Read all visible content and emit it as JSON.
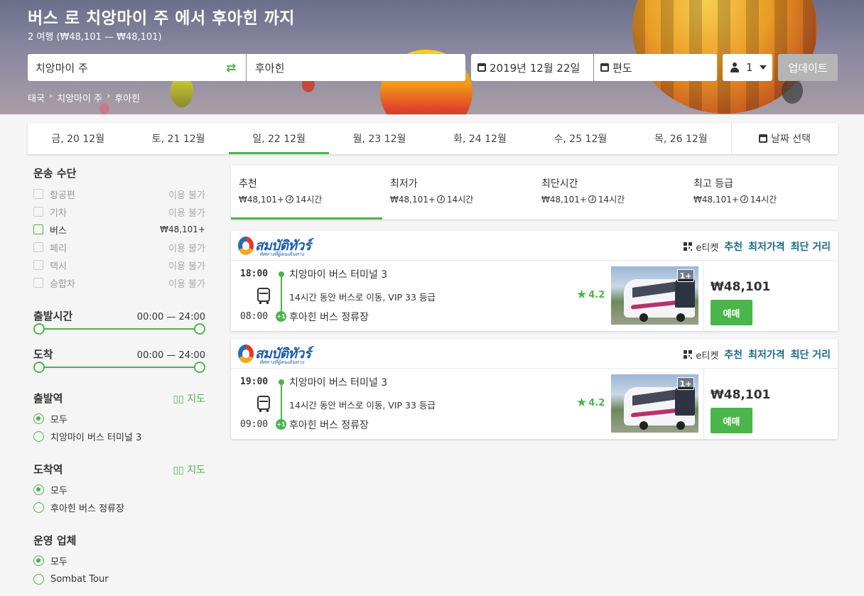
{
  "header": {
    "title": "버스 로 치앙마이 주 에서 후아힌 까지",
    "subtitle": "2 여행 (₩48,101 — ₩48,101)",
    "from": "치앙마이 주",
    "to": "후아힌",
    "date": "2019년 12월 22일",
    "return": "편도",
    "passengers": "1",
    "update_label": "업데이트",
    "breadcrumb": [
      "태국",
      "치앙마이 주",
      "후아힌"
    ]
  },
  "date_tabs": [
    "금, 20 12월",
    "토, 21 12월",
    "일, 22 12월",
    "월, 23 12월",
    "화, 24 12월",
    "수, 25 12월",
    "목, 26 12월"
  ],
  "date_pick_label": "날짜 선택",
  "filters": {
    "transport_title": "운송 수단",
    "transport": [
      {
        "label": "항공편",
        "value": "이용 불가",
        "enabled": false
      },
      {
        "label": "기차",
        "value": "이용 불가",
        "enabled": false
      },
      {
        "label": "버스",
        "value": "₩48,101+",
        "enabled": true
      },
      {
        "label": "페리",
        "value": "이용 불가",
        "enabled": false
      },
      {
        "label": "택시",
        "value": "이용 불가",
        "enabled": false
      },
      {
        "label": "승합차",
        "value": "이용 불가",
        "enabled": false
      }
    ],
    "departure_time": {
      "label": "출발시간",
      "range": "00:00 — 24:00"
    },
    "arrival": {
      "label": "도착",
      "range": "00:00 — 24:00"
    },
    "map_label": "지도",
    "departure_station": {
      "title": "출발역",
      "options": [
        "모두",
        "치앙마이 버스 터미널 3"
      ]
    },
    "arrival_station": {
      "title": "도착역",
      "options": [
        "모두",
        "후아힌 버스 정류장"
      ]
    },
    "operator": {
      "title": "운영 업체",
      "options": [
        "모두",
        "Sombat Tour"
      ]
    }
  },
  "sort_tabs": [
    {
      "name": "추천",
      "price": "₩48,101+",
      "duration": "14시간"
    },
    {
      "name": "최저가",
      "price": "₩48,101+",
      "duration": "14시간"
    },
    {
      "name": "최단시간",
      "price": "₩48,101+",
      "duration": "14시간"
    },
    {
      "name": "최고 등급",
      "price": "₩48,101+",
      "duration": "14시간"
    }
  ],
  "results": [
    {
      "operator_logo_text": "สมบัติทัวร์",
      "operator_logo_tag": "ทิศทางที่ผู้คนเดินทาง",
      "eticket": "e티켓",
      "tags": [
        "추천",
        "최저가격",
        "최단 거리"
      ],
      "dep_time": "18:00",
      "dep_station": "치앙마이 버스 터미널 3",
      "arr_time": "08:00",
      "arr_station": "후아힌 버스 정류장",
      "day_offset": "+1",
      "description": "14시간 동안 버스로 이동, VIP 33 등급",
      "rating": "4.2",
      "photo_badge": "1+",
      "price": "₩48,101",
      "book_label": "예매"
    },
    {
      "operator_logo_text": "สมบัติทัวร์",
      "operator_logo_tag": "ทิศทางที่ผู้คนเดินทาง",
      "eticket": "e티켓",
      "tags": [
        "추천",
        "최저가격",
        "최단 거리"
      ],
      "dep_time": "19:00",
      "dep_station": "치앙마이 버스 터미널 3",
      "arr_time": "09:00",
      "arr_station": "후아힌 버스 정류장",
      "day_offset": "+1",
      "description": "14시간 동안 버스로 이동, VIP 33 등급",
      "rating": "4.2",
      "photo_badge": "1+",
      "price": "₩48,101",
      "book_label": "예매"
    }
  ],
  "colors": {
    "accent": "#4ab54a",
    "tag_link": "#1a6b8a",
    "update_disabled": "#b5b5b5"
  }
}
